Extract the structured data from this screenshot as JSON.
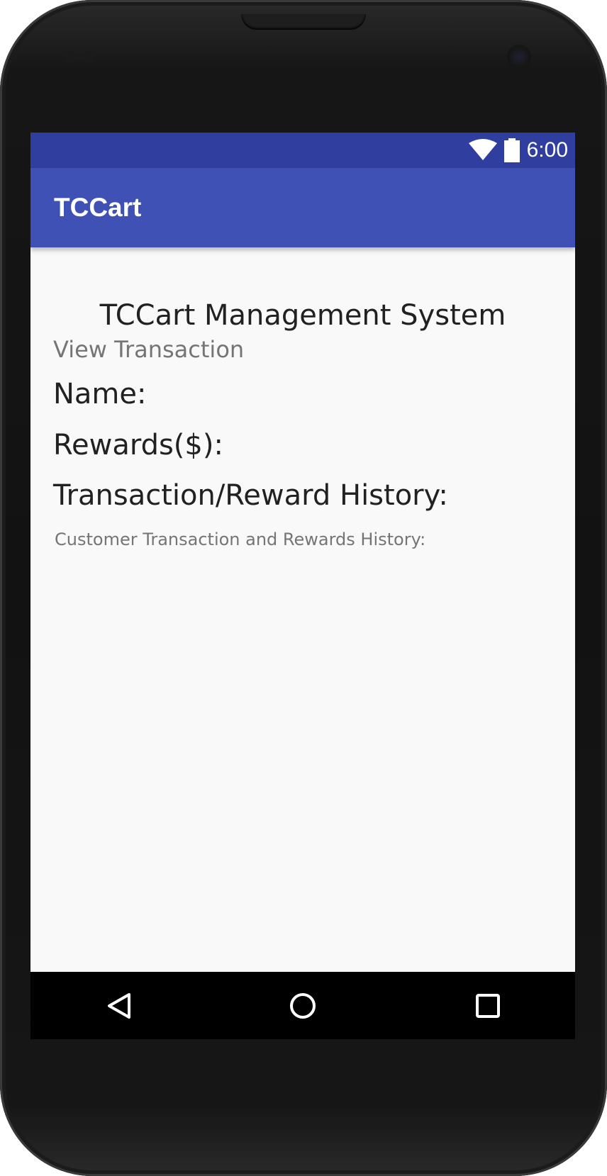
{
  "status_bar": {
    "time": "6:00",
    "icons": [
      "wifi-icon",
      "battery-icon"
    ],
    "color": "#303f9f"
  },
  "app_bar": {
    "title": "TCCart",
    "color": "#3f51b5"
  },
  "content": {
    "system_title": "TCCart Management System",
    "subtitle": "View Transaction",
    "name_label": "Name:",
    "rewards_label": "Rewards($):",
    "history_label": "Transaction/Reward History:",
    "history_hint": "Customer Transaction and Rewards History:"
  },
  "nav_bar": {
    "icons": [
      "back-icon",
      "home-icon",
      "recents-icon"
    ]
  }
}
